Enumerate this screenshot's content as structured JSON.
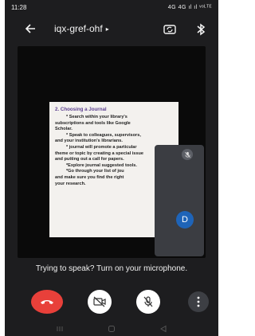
{
  "status_bar": {
    "time": "11:28",
    "indicators": "4G  4G  ıl  ıl  ᵛᵒᴸᵀᴱ"
  },
  "header": {
    "meeting_code": "iqx-gref-ohf",
    "chevron": "▸"
  },
  "slide": {
    "title": "2. Choosing a Journal",
    "lines": [
      "* Search within your library's",
      "subscriptions and tools like Google",
      "Scholar.",
      "* Speak to colleagues, supervisors,",
      "and your institution's librarians.",
      "* journal will promote a particular",
      "theme or topic by creating a special issue",
      "and putting out a call for papers.",
      "*Explore journal suggested tools.",
      "*Go through your list of jou",
      "and make sure you find the right",
      "your research."
    ]
  },
  "self_view": {
    "avatar_letter": "D"
  },
  "hint_text": "Trying to speak? Turn on your microphone.",
  "colors": {
    "background": "#1d1d1f",
    "end_call": "#e8403a",
    "avatar": "#1e64b8",
    "slide_title": "#5b3f8f"
  },
  "icons": [
    "back-arrow-icon",
    "switch-camera-icon",
    "bluetooth-icon",
    "mic-off-icon",
    "end-call-icon",
    "camera-off-icon",
    "more-vertical-icon"
  ]
}
